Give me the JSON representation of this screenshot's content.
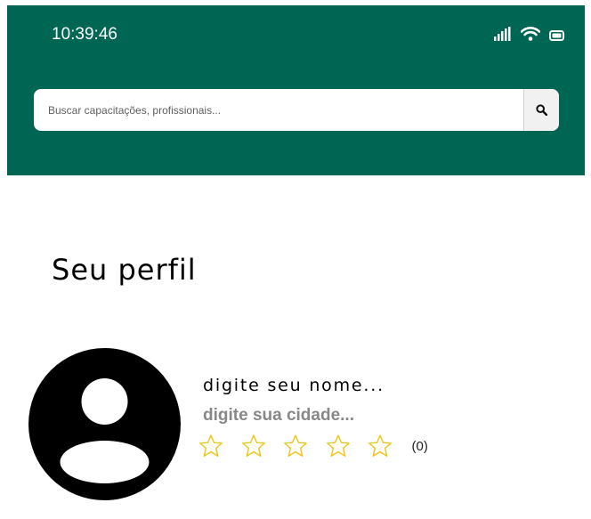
{
  "status_bar": {
    "time": "10:39:46",
    "icons": [
      "signal-icon",
      "wifi-icon",
      "battery-icon"
    ]
  },
  "search": {
    "placeholder": "Buscar capacitações, profissionais...",
    "button_icon": "search-icon"
  },
  "profile": {
    "title": "Seu perfil",
    "name_placeholder": "digite seu nome...",
    "city_placeholder": "digite sua cidade...",
    "avatar_icon": "user-avatar-icon",
    "rating": {
      "max_stars": 5,
      "value": 0,
      "count_label": "(0)"
    }
  },
  "colors": {
    "header_bg": "#006654",
    "star_outline": "#f1c40f",
    "city_text": "#888888"
  }
}
